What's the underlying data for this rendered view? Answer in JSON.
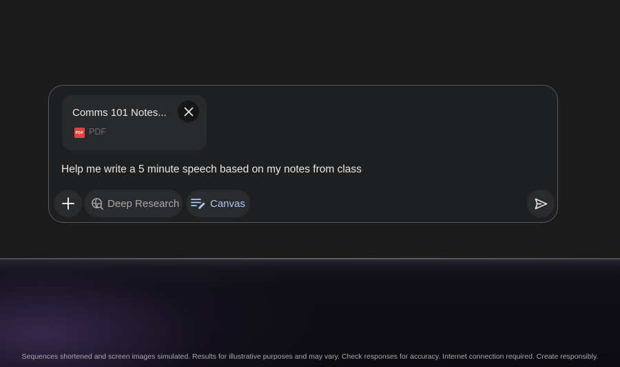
{
  "attachment": {
    "title": "Comms 101 Notes...",
    "badge": "PDF",
    "type": "PDF",
    "close_icon": "close-icon",
    "badge_color": "#e2443a"
  },
  "prompt": {
    "text": "Help me write a 5 minute speech based on my notes from class"
  },
  "toolbar": {
    "add_icon": "plus-icon",
    "deep_research_label": "Deep Research",
    "deep_research_icon": "globe-search-icon",
    "canvas_label": "Canvas",
    "canvas_icon": "canvas-edit-icon",
    "canvas_color": "#aac7f5",
    "send_icon": "send-icon"
  },
  "footer": {
    "disclaimer": "Sequences shortened and screen images simulated. Results for illustrative purposes and may vary. Check responses for accuracy. Internet connection required. Create responsibly."
  }
}
